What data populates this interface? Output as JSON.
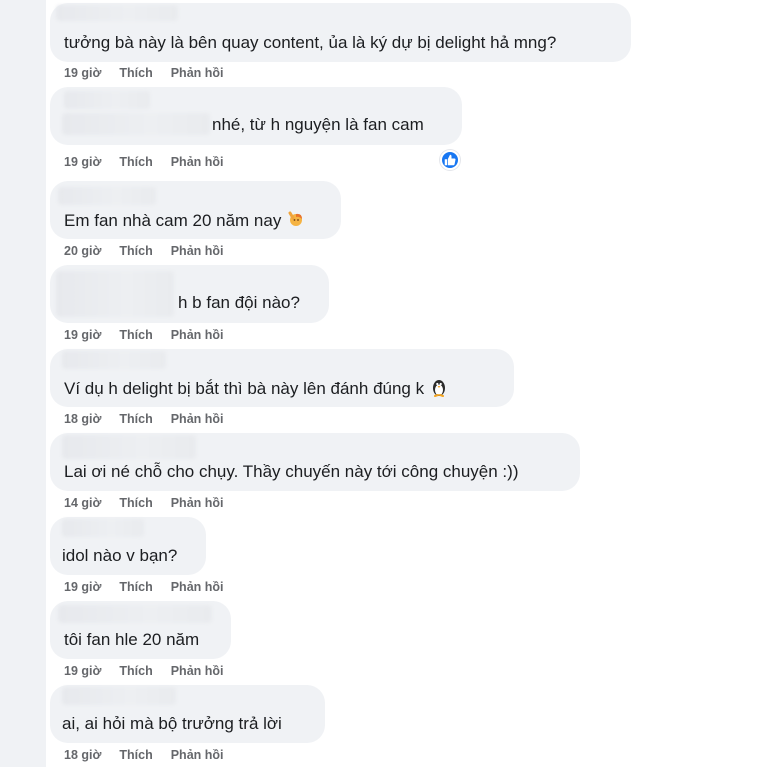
{
  "action_labels": {
    "like": "Thích",
    "reply": "Phản hồi"
  },
  "colors": {
    "bubble": "#f0f2f5",
    "action_text": "#65676b",
    "like_badge": "#1877f2"
  },
  "comments": [
    {
      "text": "tưởng bà này là bên quay content, ủa là ký dự bị delight hả mng?",
      "time": "19 giờ"
    },
    {
      "text": "nhé, từ h nguyện là fan cam",
      "time": "19 giờ",
      "reaction": "like-icon"
    },
    {
      "text": "Em fan nhà cam 20 năm nay",
      "time": "20 giờ",
      "emoji": "raising-hand-emoji"
    },
    {
      "text": "h b fan đội nào?",
      "time": "19 giờ"
    },
    {
      "text": "Ví dụ h delight bị bắt thì bà này lên đánh đúng k",
      "time": "18 giờ",
      "emoji": "penguin-emoji"
    },
    {
      "text": "Lai ơi né chỗ cho chụy. Thầy chuyến này tới công chuyện :))",
      "time": "14 giờ"
    },
    {
      "text": "idol nào v bạn?",
      "time": "19 giờ"
    },
    {
      "text": "tôi fan hle 20 năm",
      "time": "19 giờ"
    },
    {
      "text": "ai, ai hỏi mà bộ trưởng trả lời",
      "time": "18 giờ"
    }
  ]
}
